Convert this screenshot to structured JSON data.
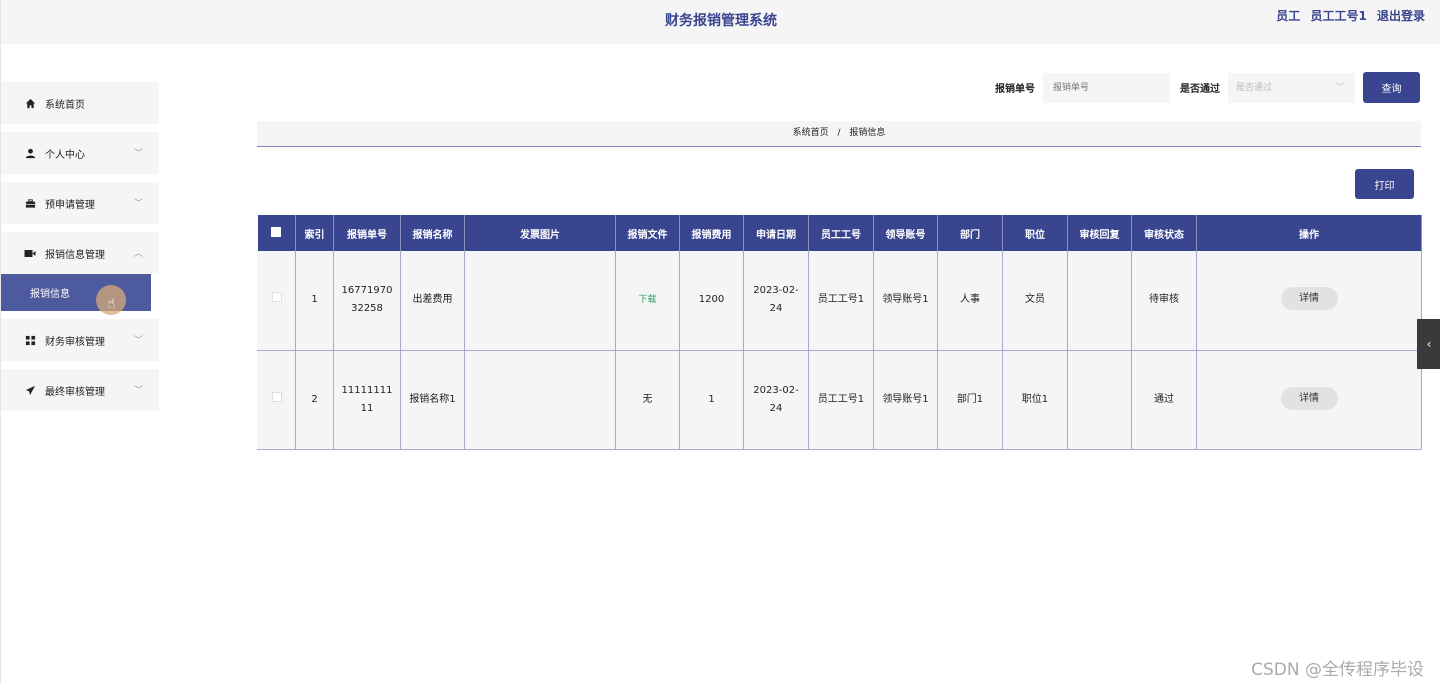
{
  "header": {
    "title": "财务报销管理系统",
    "role": "员工",
    "username": "员工工号1",
    "logout": "退出登录"
  },
  "sidebar": {
    "items": [
      {
        "label": "系统首页",
        "icon": "home-icon"
      },
      {
        "label": "个人中心",
        "icon": "user-icon"
      },
      {
        "label": "预申请管理",
        "icon": "briefcase-icon"
      },
      {
        "label": "报销信息管理",
        "icon": "film-icon"
      },
      {
        "label": "财务审核管理",
        "icon": "grid-icon"
      },
      {
        "label": "最终审核管理",
        "icon": "send-icon"
      }
    ],
    "sub_active": "报销信息"
  },
  "search": {
    "number_label": "报销单号",
    "number_placeholder": "报销单号",
    "passed_label": "是否通过",
    "passed_placeholder": "是否通过",
    "query_button": "查询"
  },
  "breadcrumb": {
    "home": "系统首页",
    "separator": "/",
    "current": "报销信息"
  },
  "print_button": "打印",
  "table": {
    "headers": [
      "索引",
      "报销单号",
      "报销名称",
      "发票图片",
      "报销文件",
      "报销费用",
      "申请日期",
      "员工工号",
      "领导账号",
      "部门",
      "职位",
      "审核回复",
      "审核状态",
      "操作"
    ],
    "rows": [
      {
        "index": "1",
        "number": "1677197032258",
        "number_l1": "16771970",
        "number_l2": "32258",
        "name": "出差费用",
        "image": "",
        "file": "下载",
        "amount": "1200",
        "date_l1": "2023-02-",
        "date_l2": "24",
        "emp": "员工工号1",
        "leader": "领导账号1",
        "dept": "人事",
        "position": "文员",
        "reply": "",
        "status": "待审核",
        "action": "详情"
      },
      {
        "index": "2",
        "number": "1111111111",
        "number_l1": "11111111",
        "number_l2": "11",
        "name": "报销名称1",
        "image": "",
        "file": "无",
        "amount": "1",
        "date_l1": "2023-02-",
        "date_l2": "24",
        "emp": "员工工号1",
        "leader": "领导账号1",
        "dept": "部门1",
        "position": "职位1",
        "reply": "",
        "status": "通过",
        "action": "详情"
      }
    ]
  },
  "watermark": "CSDN @全传程序毕设",
  "colors": {
    "primary": "#3a4590",
    "submenu_active": "#4e5a9e",
    "panel_bg": "#f6f5f6",
    "download": "#2aa06b"
  }
}
